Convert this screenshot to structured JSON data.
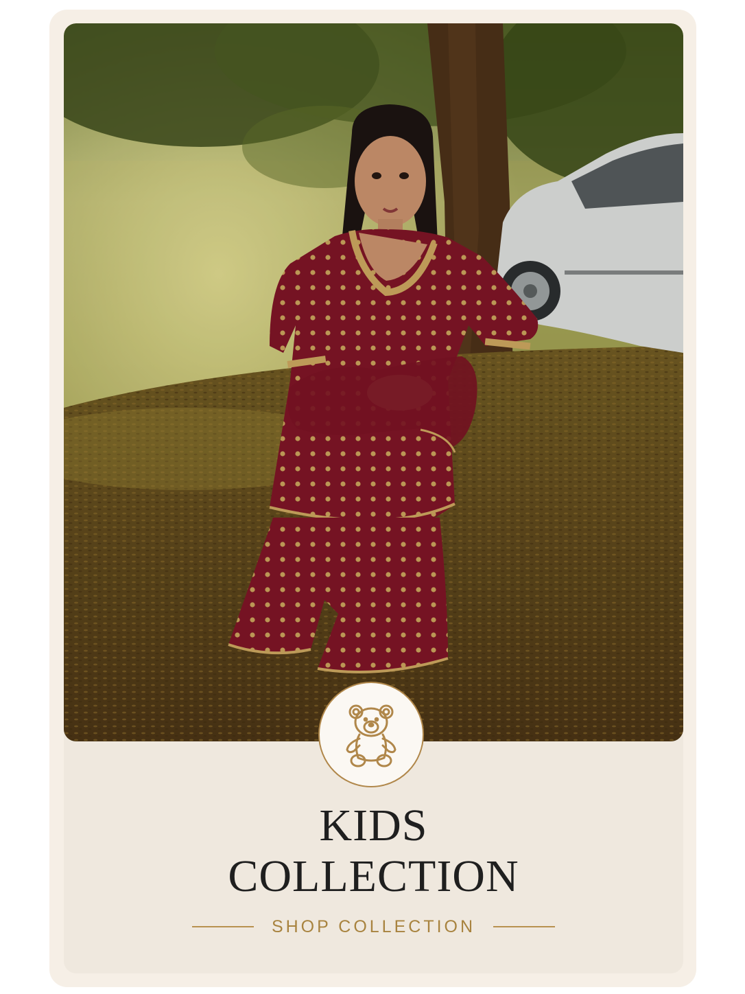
{
  "card": {
    "image_alt": "",
    "badge_icon": "teddy-bear-icon",
    "title_line1": "KIDS",
    "title_line2": "COLLECTION",
    "cta_label": "SHOP COLLECTION"
  },
  "colors": {
    "accent_gold": "#b0874a",
    "card_bg": "#efe8de",
    "outer_bg": "#f6efe6",
    "title_color": "#1f1f1f",
    "dress_maroon": "#7d1526"
  }
}
